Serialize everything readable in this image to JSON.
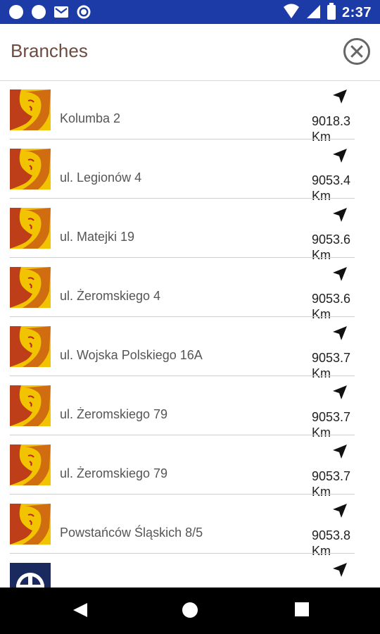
{
  "status_bar": {
    "time": "2:37",
    "left_icons": [
      "circle-icon",
      "circle-icon",
      "gmail-icon",
      "sync-icon"
    ],
    "right_icons": [
      "wifi-icon",
      "signal-icon",
      "battery-icon"
    ]
  },
  "header": {
    "title": "Branches",
    "close_icon": "close-circle-icon"
  },
  "branches": [
    {
      "name": "Kolumba 2",
      "distance": "9018.3",
      "unit": "Km"
    },
    {
      "name": "ul. Legionów 4",
      "distance": "9053.4",
      "unit": "Km"
    },
    {
      "name": "ul. Matejki 19",
      "distance": "9053.6",
      "unit": "Km"
    },
    {
      "name": "ul. Żeromskiego 4",
      "distance": "9053.6",
      "unit": "Km"
    },
    {
      "name": "ul. Wojska Polskiego 16A",
      "distance": "9053.7",
      "unit": "Km"
    },
    {
      "name": "ul. Żeromskiego 79",
      "distance": "9053.7",
      "unit": "Km"
    },
    {
      "name": "ul. Żeromskiego 79",
      "distance": "9053.7",
      "unit": "Km"
    },
    {
      "name": "Powstańców Śląskich 8/5",
      "distance": "9053.8",
      "unit": "Km"
    },
    {
      "name": "",
      "distance": "",
      "unit": ""
    }
  ],
  "nav_bar": {
    "back_icon": "back-triangle-icon",
    "home_icon": "home-circle-icon",
    "recents_icon": "recents-square-icon"
  },
  "colors": {
    "status_bar": "#1c3ba6",
    "title": "#6d4c41",
    "logo_gold": "#f1c300",
    "logo_red": "#b6271f",
    "last_logo": "#1b2a5e"
  }
}
